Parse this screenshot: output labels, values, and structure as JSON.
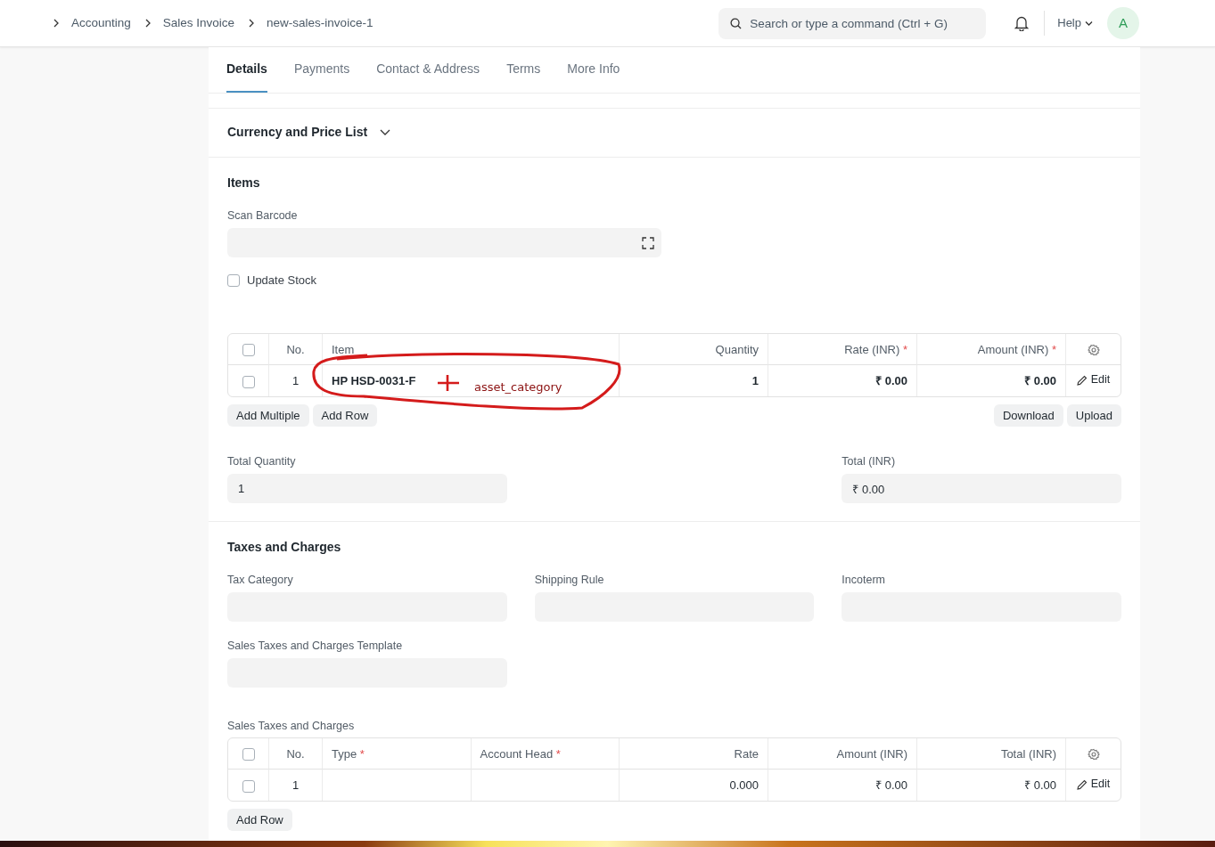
{
  "breadcrumbs": [
    "Accounting",
    "Sales Invoice",
    "new-sales-invoice-1"
  ],
  "search": {
    "placeholder": "Search or type a command (Ctrl + G)"
  },
  "help_menu": {
    "label": "Help"
  },
  "avatar": {
    "initial": "A"
  },
  "tabs": [
    {
      "label": "Details",
      "selected": true
    },
    {
      "label": "Payments",
      "selected": false
    },
    {
      "label": "Contact & Address",
      "selected": false
    },
    {
      "label": "Terms",
      "selected": false
    },
    {
      "label": "More Info",
      "selected": false
    }
  ],
  "sections": [
    {
      "kind": "collapsible",
      "title": "Currency and Price List",
      "expanded": false
    },
    {
      "kind": "blocks",
      "title": "Items",
      "blocks": [
        {
          "kind": "barcode",
          "label": "Scan Barcode"
        },
        {
          "kind": "checkbox",
          "label": "Update Stock",
          "checked": false
        },
        {
          "kind": "table",
          "all_selected": false,
          "bold_values": true,
          "columns": [
            {
              "label": "No.",
              "kind": "index"
            },
            {
              "label": "Item",
              "kind": "text"
            },
            {
              "label": "Quantity",
              "kind": "numeric"
            },
            {
              "label": "Rate (INR)",
              "kind": "numeric",
              "mark": "*"
            },
            {
              "label": "Amount (INR)",
              "kind": "numeric",
              "mark": "*"
            }
          ],
          "rows": [
            {
              "selected": false,
              "cells": [
                "1",
                "HP HSD-0031-F",
                "1",
                "₹ 0.00",
                "₹ 0.00"
              ],
              "action": "Edit"
            }
          ],
          "buttons_left": [
            "Add Multiple",
            "Add Row"
          ],
          "buttons_right": [
            "Download",
            "Upload"
          ],
          "annotation": {
            "text": "asset_category"
          }
        },
        {
          "kind": "totals",
          "fields": [
            {
              "label": "Total Quantity",
              "value": "1"
            },
            {
              "label": "Total (INR)",
              "value": "₹ 0.00"
            }
          ]
        }
      ]
    },
    {
      "kind": "blocks",
      "title": "Taxes and Charges",
      "blocks": [
        {
          "kind": "fields",
          "fields": [
            {
              "label": "Tax Category"
            },
            {
              "label": "Shipping Rule"
            },
            {
              "label": "Incoterm"
            }
          ]
        },
        {
          "kind": "fields",
          "fields": [
            {
              "label": "Sales Taxes and Charges Template"
            }
          ]
        },
        {
          "kind": "table",
          "caption": "Sales Taxes and Charges",
          "all_selected": false,
          "bold_values": false,
          "columns": [
            {
              "label": "No.",
              "kind": "index"
            },
            {
              "label": "Type",
              "kind": "text",
              "mark": "*"
            },
            {
              "label": "Account Head",
              "kind": "text",
              "mark": "*"
            },
            {
              "label": "Rate",
              "kind": "numeric"
            },
            {
              "label": "Amount (INR)",
              "kind": "numeric"
            },
            {
              "label": "Total (INR)",
              "kind": "numeric"
            }
          ],
          "rows": [
            {
              "selected": false,
              "cells": [
                "1",
                null,
                null,
                "0.000",
                "₹ 0.00",
                "₹ 0.00"
              ],
              "action": "Edit"
            }
          ],
          "buttons_left": [
            "Add Row"
          ]
        }
      ]
    }
  ]
}
